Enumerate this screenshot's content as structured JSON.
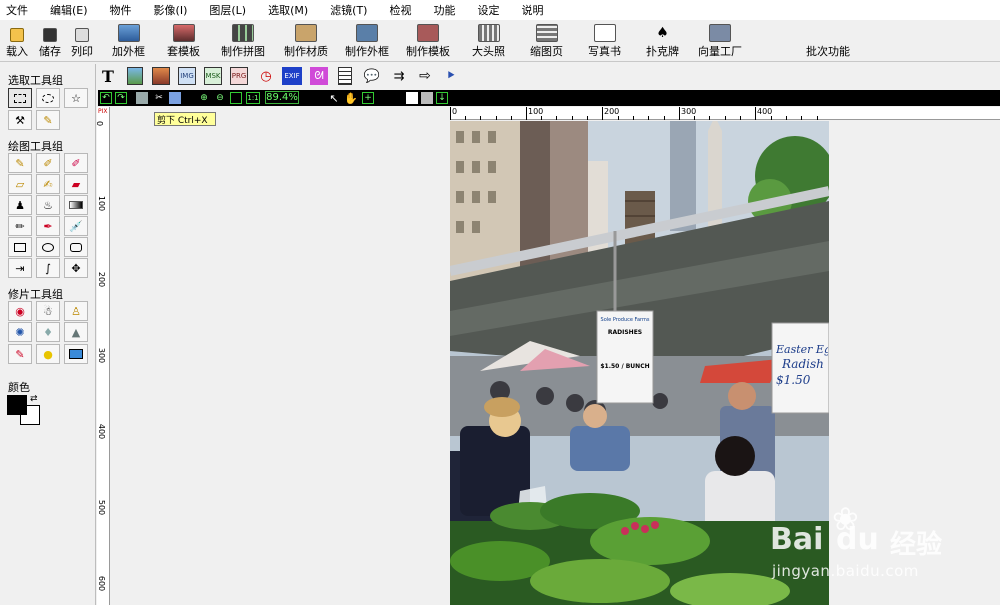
{
  "menu": [
    "文件",
    "编辑(E)",
    "物件",
    "影像(I)",
    "图层(L)",
    "选取(M)",
    "滤镜(T)",
    "检视",
    "功能",
    "设定",
    "说明"
  ],
  "toolbar": {
    "load": "载入",
    "save": "储存",
    "print": "列印",
    "frame": "加外框",
    "template": "套模板",
    "collage": "制作拼图",
    "material": "制作材质",
    "make_frame": "制作外框",
    "make_template": "制作模板",
    "bighead": "大头照",
    "thumb": "缩图页",
    "album": "写真书",
    "poker": "扑克牌",
    "vector": "向量工厂",
    "batch": "批次功能"
  },
  "left": {
    "select_group": "选取工具组",
    "draw_group": "绘图工具组",
    "retouch_group": "修片工具组",
    "color": "颜色"
  },
  "view": {
    "zoom": "89.4%",
    "tooltip": "剪下  Ctrl+X",
    "ruler_h": [
      "0",
      "100",
      "200",
      "300",
      "400"
    ],
    "ruler_v": [
      "0",
      "100",
      "200",
      "300",
      "400",
      "500",
      "600"
    ],
    "pix": "PIX"
  },
  "photo": {
    "sign_left_top": "Sole Produce Farms",
    "sign_left_item": "RADISHES",
    "sign_left_price": "$1.50 / BUNCH",
    "sign_right_1": "Easter Egg",
    "sign_right_2": "Radish",
    "sign_right_3": "$1.50"
  },
  "watermark": {
    "brand": "Bai",
    "brand2": "du",
    "cn": "经验",
    "url": "jingyan.baidu.com"
  },
  "colors": {
    "fg": "#000000",
    "bg": "#ffffff",
    "darkbar": "#000000",
    "tooltip": "#ffff9a"
  }
}
